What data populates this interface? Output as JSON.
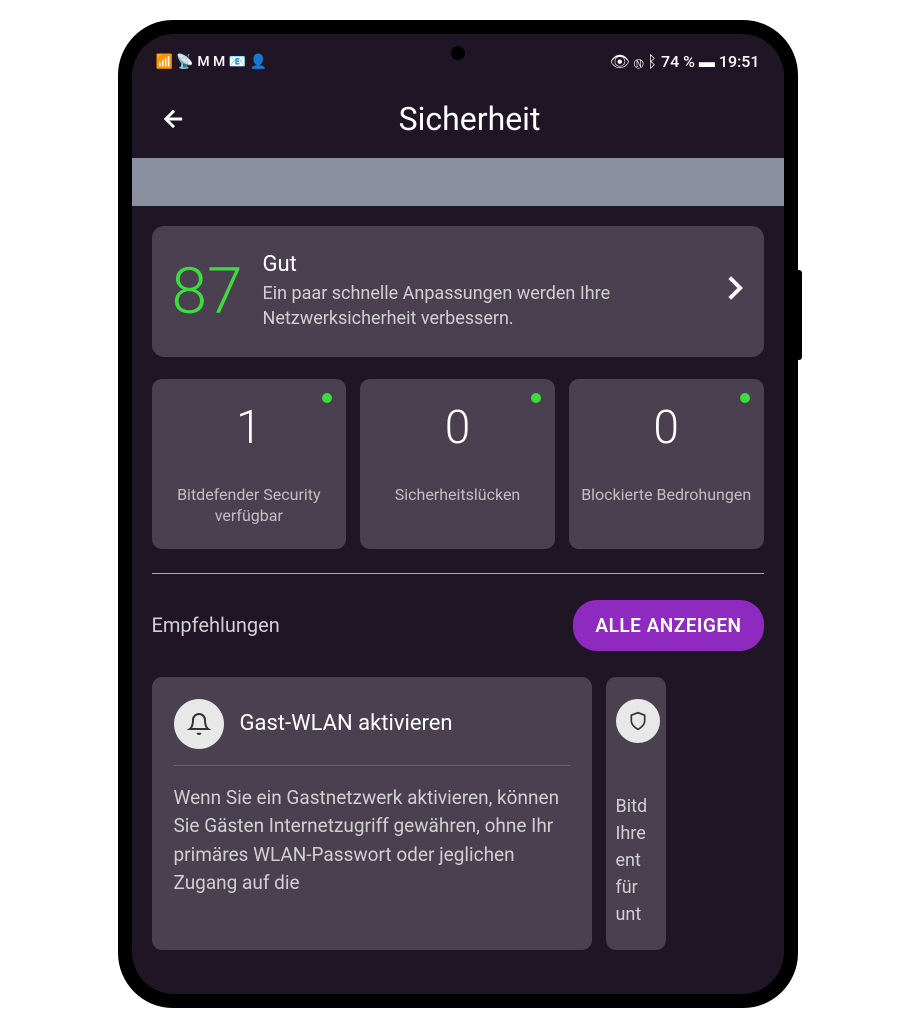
{
  "statusBar": {
    "leftIcons": "📶 📡 M M 📧 👤",
    "rightGroup": "👁 Ⓝ ᛒ 74 % ▬ 19:51"
  },
  "header": {
    "title": "Sicherheit"
  },
  "scoreCard": {
    "value": "87",
    "label": "Gut",
    "description": "Ein paar schnelle Anpassungen werden Ihre Netzwerksicherheit verbessern."
  },
  "stats": [
    {
      "value": "1",
      "label": "Bitdefender Security verfügbar"
    },
    {
      "value": "0",
      "label": "Sicherheitslücken"
    },
    {
      "value": "0",
      "label": "Blockierte Bedrohungen"
    }
  ],
  "recommendations": {
    "title": "Empfehlungen",
    "showAllButton": "ALLE ANZEIGEN",
    "cards": [
      {
        "title": "Gast-WLAN aktivieren",
        "body": "Wenn Sie ein Gastnetzwerk aktivieren, können Sie Gästen Internetzugriff gewähren, ohne Ihr primäres WLAN-Passwort oder jeglichen Zugang auf die"
      },
      {
        "partialBody": "Bitd\nIhre\nent\nfür\nunt"
      }
    ]
  }
}
